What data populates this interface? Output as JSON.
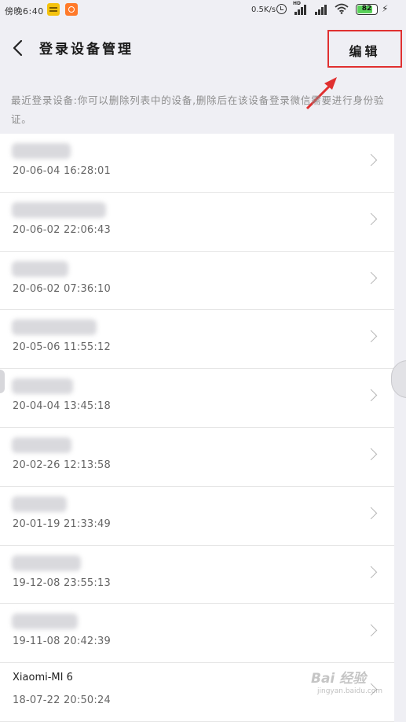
{
  "status_bar": {
    "time": "傍晚6:40",
    "net_speed": "0.5K/s",
    "hd_label": "HD",
    "battery": "82",
    "battery_level_percent": 82,
    "icons": [
      "notification-app-icon",
      "notification-app-icon",
      "alarm-icon",
      "signal-icon",
      "signal-icon",
      "wifi-icon",
      "battery-icon",
      "charging-icon"
    ]
  },
  "nav": {
    "title": "登录设备管理",
    "edit_label": "编辑",
    "back_icon": "chevron-left-icon"
  },
  "hint": "最近登录设备:你可以删除列表中的设备,删除后在该设备登录微信需要进行身份验证。",
  "devices": [
    {
      "name": "",
      "time": "20-06-04 16:28:01"
    },
    {
      "name": "",
      "time": "20-06-02 22:06:43"
    },
    {
      "name": "",
      "time": "20-06-02 07:36:10"
    },
    {
      "name": "",
      "time": "20-05-06 11:55:12"
    },
    {
      "name": "",
      "time": "20-04-04 13:45:18"
    },
    {
      "name": "",
      "time": "20-02-26 12:13:58"
    },
    {
      "name": "",
      "time": "20-01-19 21:33:49"
    },
    {
      "name": "",
      "time": "19-12-08 23:55:13"
    },
    {
      "name": "",
      "time": "19-11-08 20:42:39"
    },
    {
      "name": "Xiaomi-MI 6",
      "time": "18-07-22 20:50:24"
    }
  ],
  "watermark": {
    "main": "Bai 经验",
    "sub": "jingyan.baidu.com"
  },
  "colors": {
    "background": "#efeff4",
    "highlight_box": "#e03030",
    "hint_text": "#8d8d8d"
  }
}
